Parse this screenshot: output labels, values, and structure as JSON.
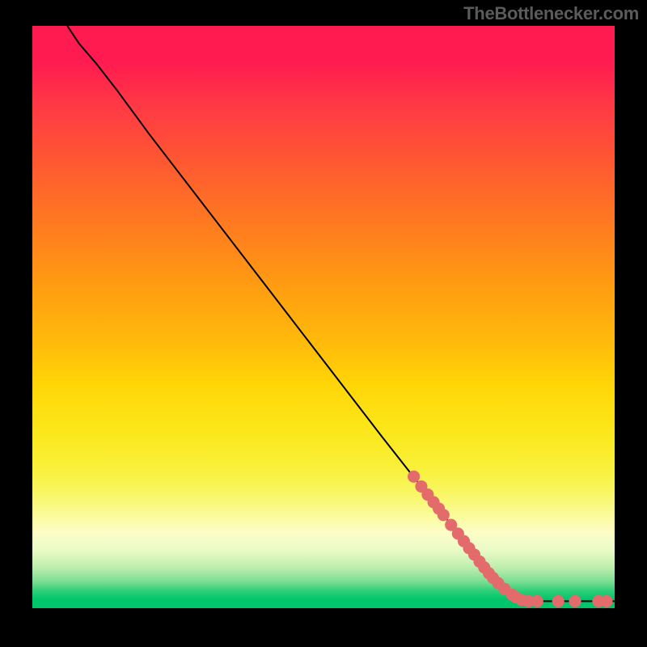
{
  "attribution": "TheBottlenecker.com",
  "chart_data": {
    "type": "line",
    "title": "",
    "xlabel": "",
    "ylabel": "",
    "xlim": [
      0,
      100
    ],
    "ylim": [
      0,
      100
    ],
    "curve": [
      {
        "x": 6.0,
        "y": 100.0
      },
      {
        "x": 8.0,
        "y": 97.0
      },
      {
        "x": 11.0,
        "y": 93.5
      },
      {
        "x": 14.5,
        "y": 89.0
      },
      {
        "x": 20.0,
        "y": 81.5
      },
      {
        "x": 30.0,
        "y": 68.5
      },
      {
        "x": 40.0,
        "y": 55.5
      },
      {
        "x": 50.0,
        "y": 42.5
      },
      {
        "x": 60.0,
        "y": 29.5
      },
      {
        "x": 70.0,
        "y": 16.8
      },
      {
        "x": 76.0,
        "y": 9.0
      },
      {
        "x": 80.0,
        "y": 4.3
      },
      {
        "x": 82.5,
        "y": 2.2
      },
      {
        "x": 84.0,
        "y": 1.4
      },
      {
        "x": 86.0,
        "y": 1.2
      },
      {
        "x": 90.0,
        "y": 1.2
      },
      {
        "x": 95.0,
        "y": 1.2
      },
      {
        "x": 100.0,
        "y": 1.2
      }
    ],
    "markers": [
      {
        "x": 65.5,
        "y": 22.6
      },
      {
        "x": 66.8,
        "y": 20.9
      },
      {
        "x": 67.9,
        "y": 19.5
      },
      {
        "x": 68.9,
        "y": 18.2
      },
      {
        "x": 69.8,
        "y": 17.1
      },
      {
        "x": 70.6,
        "y": 16.0
      },
      {
        "x": 71.9,
        "y": 14.3
      },
      {
        "x": 73.1,
        "y": 12.8
      },
      {
        "x": 74.1,
        "y": 11.5
      },
      {
        "x": 75.0,
        "y": 10.3
      },
      {
        "x": 75.9,
        "y": 9.2
      },
      {
        "x": 76.8,
        "y": 8.0
      },
      {
        "x": 77.6,
        "y": 7.0
      },
      {
        "x": 78.4,
        "y": 6.0
      },
      {
        "x": 79.1,
        "y": 5.2
      },
      {
        "x": 80.0,
        "y": 4.3
      },
      {
        "x": 81.1,
        "y": 3.3
      },
      {
        "x": 82.4,
        "y": 2.3
      },
      {
        "x": 83.0,
        "y": 1.9
      },
      {
        "x": 84.0,
        "y": 1.4
      },
      {
        "x": 85.2,
        "y": 1.2
      },
      {
        "x": 86.7,
        "y": 1.2
      },
      {
        "x": 90.3,
        "y": 1.2
      },
      {
        "x": 93.2,
        "y": 1.2
      },
      {
        "x": 97.2,
        "y": 1.2
      },
      {
        "x": 98.6,
        "y": 1.2
      }
    ],
    "marker_color": "#e46b6b",
    "curve_color": "#000000"
  }
}
